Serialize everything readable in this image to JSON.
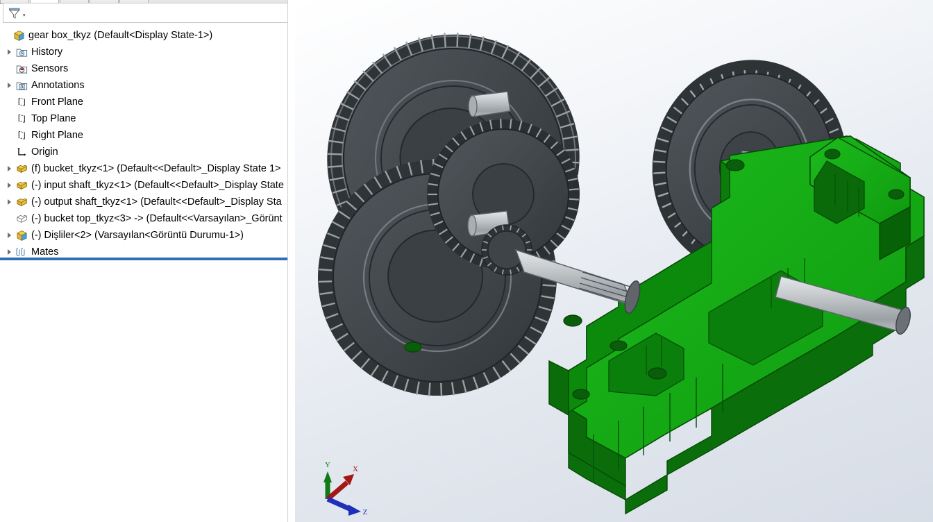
{
  "app": {
    "title": "gear box_tkyz",
    "tabs": [
      {
        "name": "feature-manager-tab",
        "glyph": "☲"
      },
      {
        "name": "property-manager-tab",
        "glyph": "▤"
      },
      {
        "name": "configuration-manager-tab",
        "glyph": "≡"
      },
      {
        "name": "dimxpert-manager-tab",
        "glyph": "△"
      },
      {
        "name": "display-manager-tab",
        "glyph": "●"
      }
    ]
  },
  "filter": {
    "icon": "filter-funnel-icon",
    "caret": "▾",
    "placeholder": ""
  },
  "tree": {
    "root": {
      "label": "gear box_tkyz  (Default<Display State-1>)",
      "icon": "assembly-icon",
      "expandable": false
    },
    "items": [
      {
        "label": "History",
        "icon": "history-folder-icon",
        "expandable": true,
        "indent": 1
      },
      {
        "label": "Sensors",
        "icon": "sensors-folder-icon",
        "expandable": false,
        "indent": 1
      },
      {
        "label": "Annotations",
        "icon": "annotations-folder-icon",
        "expandable": true,
        "indent": 1
      },
      {
        "label": "Front Plane",
        "icon": "plane-icon",
        "expandable": false,
        "indent": 1
      },
      {
        "label": "Top Plane",
        "icon": "plane-icon",
        "expandable": false,
        "indent": 1
      },
      {
        "label": "Right Plane",
        "icon": "plane-icon",
        "expandable": false,
        "indent": 1
      },
      {
        "label": "Origin",
        "icon": "origin-icon",
        "expandable": false,
        "indent": 1
      },
      {
        "label": "(f) bucket_tkyz<1>  (Default<<Default>_Display State 1>",
        "icon": "part-icon",
        "expandable": true,
        "indent": 1
      },
      {
        "label": "(-) input shaft_tkyz<1>  (Default<<Default>_Display State",
        "icon": "part-icon",
        "expandable": true,
        "indent": 1
      },
      {
        "label": "(-) output shaft_tkyz<1>  (Default<<Default>_Display Sta",
        "icon": "part-icon",
        "expandable": true,
        "indent": 1
      },
      {
        "label": "(-) bucket top_tkyz<3> ->  (Default<<Varsayılan>_Görünt",
        "icon": "part-outline-icon",
        "expandable": false,
        "indent": 1
      },
      {
        "label": "(-) Dişliler<2>  (Varsayılan<Görüntü Durumu-1>)",
        "icon": "assembly-icon",
        "expandable": true,
        "indent": 1
      },
      {
        "label": "Mates",
        "icon": "mates-icon",
        "expandable": true,
        "indent": 1
      }
    ]
  },
  "viewport": {
    "triad": {
      "x_label": "X",
      "y_label": "Y",
      "z_label": "Z",
      "x_color": "#a51616",
      "y_color": "#0f7a18",
      "z_color": "#1d2fbb"
    },
    "colors": {
      "housing_green": "#13a013",
      "housing_green_dark": "#0a6b0a",
      "housing_green_darker": "#075407",
      "gear_dark": "#3f4448",
      "gear_face": "#474d52",
      "shaft_gray": "#b9bdc0",
      "background_top": "#ffffff",
      "background_bottom": "#d7dde6"
    },
    "model_name": "gear box assembly"
  }
}
